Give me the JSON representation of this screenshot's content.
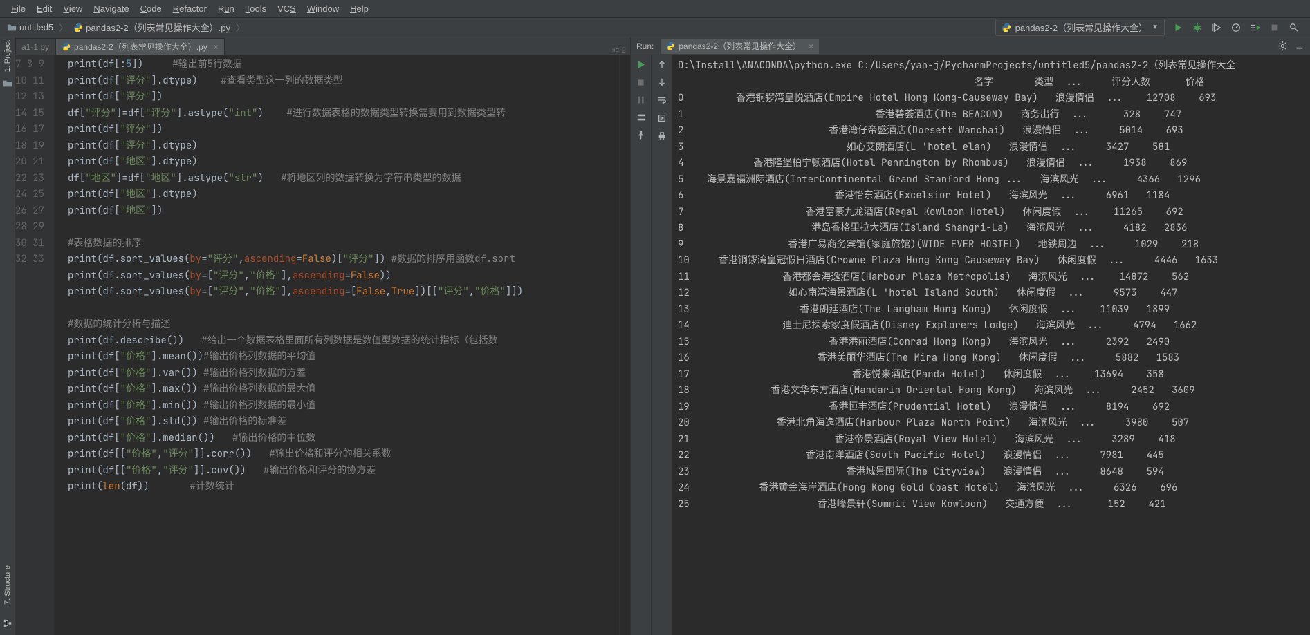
{
  "menu": [
    "File",
    "Edit",
    "View",
    "Navigate",
    "Code",
    "Refactor",
    "Run",
    "Tools",
    "VCS",
    "Window",
    "Help"
  ],
  "menu_underlines": [
    "F",
    "E",
    "V",
    "N",
    "C",
    "R",
    "u",
    "T",
    "S",
    "W",
    "H"
  ],
  "breadcrumb": {
    "project": "untitled5",
    "file": "pandas2-2（列表常见操作大全）.py"
  },
  "run_config": "pandas2-2（列表常见操作大全）",
  "tabs": {
    "inactive": "a1-1.py",
    "active": "pandas2-2（列表常见操作大全）.py",
    "info": "⇥≡ 2"
  },
  "left_tools": {
    "project": "1: Project",
    "structure": "7: Structure"
  },
  "gutter_start": 7,
  "gutter_end": 33,
  "code": [
    {
      "t": [
        [
          "fn",
          "print"
        ],
        [
          "p",
          "(df[:"
        ],
        [
          "num",
          "5"
        ],
        [
          "p",
          "])     "
        ],
        [
          "comment",
          "#输出前5行数据"
        ]
      ]
    },
    {
      "t": [
        [
          "fn",
          "print"
        ],
        [
          "p",
          "(df["
        ],
        [
          "str",
          "\"评分\""
        ],
        [
          "p",
          "].dtype)    "
        ],
        [
          "comment",
          "#查看类型这一列的数据类型"
        ]
      ]
    },
    {
      "t": [
        [
          "fn",
          "print"
        ],
        [
          "p",
          "(df["
        ],
        [
          "str",
          "\"评分\""
        ],
        [
          "p",
          "])"
        ]
      ]
    },
    {
      "t": [
        [
          "p",
          "df["
        ],
        [
          "str",
          "\"评分\""
        ],
        [
          "p",
          "]=df["
        ],
        [
          "str",
          "\"评分\""
        ],
        [
          "p",
          "].astype("
        ],
        [
          "str",
          "\"int\""
        ],
        [
          "p",
          ")    "
        ],
        [
          "comment",
          "#进行数据表格的数据类型转换需要用到数据类型转"
        ]
      ]
    },
    {
      "t": [
        [
          "fn",
          "print"
        ],
        [
          "p",
          "(df["
        ],
        [
          "str",
          "\"评分\""
        ],
        [
          "p",
          "])"
        ]
      ]
    },
    {
      "t": [
        [
          "fn",
          "print"
        ],
        [
          "p",
          "(df["
        ],
        [
          "str",
          "\"评分\""
        ],
        [
          "p",
          "].dtype)"
        ]
      ]
    },
    {
      "t": [
        [
          "fn",
          "print"
        ],
        [
          "p",
          "(df["
        ],
        [
          "str",
          "\"地区\""
        ],
        [
          "p",
          "].dtype)"
        ]
      ]
    },
    {
      "t": [
        [
          "p",
          "df["
        ],
        [
          "str",
          "\"地区\""
        ],
        [
          "p",
          "]=df["
        ],
        [
          "str",
          "\"地区\""
        ],
        [
          "p",
          "].astype("
        ],
        [
          "str",
          "\"str\""
        ],
        [
          "p",
          ")   "
        ],
        [
          "comment",
          "#将地区列的数据转换为字符串类型的数据"
        ]
      ]
    },
    {
      "t": [
        [
          "fn",
          "print"
        ],
        [
          "p",
          "(df["
        ],
        [
          "str",
          "\"地区\""
        ],
        [
          "p",
          "].dtype)"
        ]
      ]
    },
    {
      "t": [
        [
          "fn",
          "print"
        ],
        [
          "p",
          "(df["
        ],
        [
          "str",
          "\"地区\""
        ],
        [
          "p",
          "])"
        ]
      ]
    },
    {
      "t": []
    },
    {
      "t": [
        [
          "comment",
          "#表格数据的排序"
        ]
      ]
    },
    {
      "t": [
        [
          "fn",
          "print"
        ],
        [
          "p",
          "(df.sort_values("
        ],
        [
          "param",
          "by"
        ],
        [
          "p",
          "="
        ],
        [
          "str",
          "\"评分\""
        ],
        [
          "p",
          ","
        ],
        [
          "param",
          "ascending"
        ],
        [
          "p",
          "="
        ],
        [
          "kw",
          "False"
        ],
        [
          "p",
          ")["
        ],
        [
          "str",
          "\"评分\""
        ],
        [
          "p",
          "]) "
        ],
        [
          "comment",
          "#数据的排序用函数df.sort"
        ]
      ]
    },
    {
      "t": [
        [
          "fn",
          "print"
        ],
        [
          "p",
          "(df.sort_values("
        ],
        [
          "param",
          "by"
        ],
        [
          "p",
          "=["
        ],
        [
          "str",
          "\"评分\""
        ],
        [
          "p",
          ","
        ],
        [
          "str",
          "\"价格\""
        ],
        [
          "p",
          "],"
        ],
        [
          "param",
          "ascending"
        ],
        [
          "p",
          "="
        ],
        [
          "kw",
          "False"
        ],
        [
          "p",
          "))"
        ]
      ]
    },
    {
      "t": [
        [
          "fn",
          "print"
        ],
        [
          "p",
          "(df.sort_values("
        ],
        [
          "param",
          "by"
        ],
        [
          "p",
          "=["
        ],
        [
          "str",
          "\"评分\""
        ],
        [
          "p",
          ","
        ],
        [
          "str",
          "\"价格\""
        ],
        [
          "p",
          "],"
        ],
        [
          "param",
          "ascending"
        ],
        [
          "p",
          "=["
        ],
        [
          "kw",
          "False"
        ],
        [
          "p",
          ","
        ],
        [
          "kw",
          "True"
        ],
        [
          "p",
          "])[["
        ],
        [
          "str",
          "\"评分\""
        ],
        [
          "p",
          ","
        ],
        [
          "str",
          "\"价格\""
        ],
        [
          "p",
          "]])"
        ]
      ]
    },
    {
      "t": []
    },
    {
      "t": [
        [
          "comment",
          "#数据的统计分析与描述"
        ]
      ]
    },
    {
      "t": [
        [
          "fn",
          "print"
        ],
        [
          "p",
          "(df.describe())   "
        ],
        [
          "comment",
          "#给出一个数据表格里面所有列数据是数值型数据的统计指标（包括数"
        ]
      ]
    },
    {
      "t": [
        [
          "fn",
          "print"
        ],
        [
          "p",
          "(df["
        ],
        [
          "str",
          "\"价格\""
        ],
        [
          "p",
          "].mean())"
        ],
        [
          "comment",
          "#输出价格列数据的平均值"
        ]
      ]
    },
    {
      "t": [
        [
          "fn",
          "print"
        ],
        [
          "p",
          "(df["
        ],
        [
          "str",
          "\"价格\""
        ],
        [
          "p",
          "].var()) "
        ],
        [
          "comment",
          "#输出价格列数据的方差"
        ]
      ]
    },
    {
      "t": [
        [
          "fn",
          "print"
        ],
        [
          "p",
          "(df["
        ],
        [
          "str",
          "\"价格\""
        ],
        [
          "p",
          "].max()) "
        ],
        [
          "comment",
          "#输出价格列数据的最大值"
        ]
      ]
    },
    {
      "t": [
        [
          "fn",
          "print"
        ],
        [
          "p",
          "(df["
        ],
        [
          "str",
          "\"价格\""
        ],
        [
          "p",
          "].min()) "
        ],
        [
          "comment",
          "#输出价格列数据的最小值"
        ]
      ]
    },
    {
      "t": [
        [
          "fn",
          "print"
        ],
        [
          "p",
          "(df["
        ],
        [
          "str",
          "\"价格\""
        ],
        [
          "p",
          "].std()) "
        ],
        [
          "comment",
          "#输出价格的标准差"
        ]
      ]
    },
    {
      "t": [
        [
          "fn",
          "print"
        ],
        [
          "p",
          "(df["
        ],
        [
          "str",
          "\"价格\""
        ],
        [
          "p",
          "].median())   "
        ],
        [
          "comment",
          "#输出价格的中位数"
        ]
      ]
    },
    {
      "t": [
        [
          "fn",
          "print"
        ],
        [
          "p",
          "(df[["
        ],
        [
          "str",
          "\"价格\""
        ],
        [
          "p",
          ","
        ],
        [
          "str",
          "\"评分\""
        ],
        [
          "p",
          "]].corr())   "
        ],
        [
          "comment",
          "#输出价格和评分的相关系数"
        ]
      ]
    },
    {
      "t": [
        [
          "fn",
          "print"
        ],
        [
          "p",
          "(df[["
        ],
        [
          "str",
          "\"价格\""
        ],
        [
          "p",
          ","
        ],
        [
          "str",
          "\"评分\""
        ],
        [
          "p",
          "]].cov())   "
        ],
        [
          "comment",
          "#输出价格和评分的协方差"
        ]
      ]
    },
    {
      "t": [
        [
          "fn",
          "print"
        ],
        [
          "p",
          "("
        ],
        [
          "kw",
          "len"
        ],
        [
          "p",
          "(df))       "
        ],
        [
          "comment",
          "#计数统计"
        ]
      ]
    }
  ],
  "run": {
    "label": "Run:",
    "tab": "pandas2-2（列表常见操作大全）",
    "cmd": "D:\\Install\\ANACONDA\\python.exe C:/Users/yan-j/PycharmProjects/untitled5/pandas2-2（列表常见操作大全",
    "header": "                                                   名字       类型  ...     评分人数      价格",
    "rows": [
      [
        "0",
        "       香港铜锣湾皇悦酒店(Empire Hotel Hong Kong-Causeway Bay)   浪漫情侣  ...    12708    693"
      ],
      [
        "1",
        "                               香港碧荟酒店(The BEACON)   商务出行  ...      328    747"
      ],
      [
        "2",
        "                       香港湾仔帝盛酒店(Dorsett Wanchai)   浪漫情侣  ...     5014    693"
      ],
      [
        "3",
        "                          如心艾朗酒店(L 'hotel elan)   浪漫情侣  ...     3427    581"
      ],
      [
        "4",
        "          香港隆堡柏宁顿酒店(Hotel Pennington by Rhombus)   浪漫情侣  ...     1938    869"
      ],
      [
        "5",
        "  海景嘉福洲际酒店(InterContinental Grand Stanford Hong ...   海滨风光  ...     4366   1296"
      ],
      [
        "6",
        "                        香港怡东酒店(Excelsior Hotel)   海滨风光  ...     6961   1184"
      ],
      [
        "7",
        "                   香港富豪九龙酒店(Regal Kowloon Hotel)   休闲度假  ...    11265    692"
      ],
      [
        "8",
        "                    港岛香格里拉大酒店(Island Shangri-La)   海滨风光  ...     4182   2836"
      ],
      [
        "9",
        "                香港广易商务宾馆(家庭旅馆)(WIDE EVER HOSTEL)   地铁周边  ...     1029    218"
      ],
      [
        "10",
        "    香港铜锣湾皇冠假日酒店(Crowne Plaza Hong Kong Causeway Bay)   休闲度假  ...     4446   1633"
      ],
      [
        "11",
        "               香港都会海逸酒店(Harbour Plaza Metropolis)   海滨风光  ...    14872    562"
      ],
      [
        "12",
        "                如心南湾海景酒店(L 'hotel Island South)   休闲度假  ...     9573    447"
      ],
      [
        "13",
        "                  香港朗廷酒店(The Langham Hong Kong)   休闲度假  ...    11039   1899"
      ],
      [
        "14",
        "               迪士尼探索家度假酒店(Disney Explorers Lodge)   海滨风光  ...     4794   1662"
      ],
      [
        "15",
        "                       香港港丽酒店(Conrad Hong Kong)   海滨风光  ...     2392   2490"
      ],
      [
        "16",
        "                     香港美丽华酒店(The Mira Hong Kong)   休闲度假  ...     5882   1583"
      ],
      [
        "17",
        "                           香港悦来酒店(Panda Hotel)   休闲度假  ...    13694    358"
      ],
      [
        "18",
        "             香港文华东方酒店(Mandarin Oriental Hong Kong)   海滨风光  ...     2452   3609"
      ],
      [
        "19",
        "                       香港恒丰酒店(Prudential Hotel)   浪漫情侣  ...     8194    692"
      ],
      [
        "20",
        "              香港北角海逸酒店(Harbour Plaza North Point)   海滨风光  ...     3980    507"
      ],
      [
        "21",
        "                        香港帝景酒店(Royal View Hotel)   海滨风光  ...     3289    418"
      ],
      [
        "22",
        "                   香港南洋酒店(South Pacific Hotel)   浪漫情侣  ...     7981    445"
      ],
      [
        "23",
        "                          香港城景国际(The Cityview)   浪漫情侣  ...     8648    594"
      ],
      [
        "24",
        "           香港黄金海岸酒店(Hong Kong Gold Coast Hotel)   海滨风光  ...     6326    696"
      ],
      [
        "25",
        "                     香港峰景轩(Summit View Kowloon)   交通方便  ...      152    421"
      ]
    ]
  }
}
